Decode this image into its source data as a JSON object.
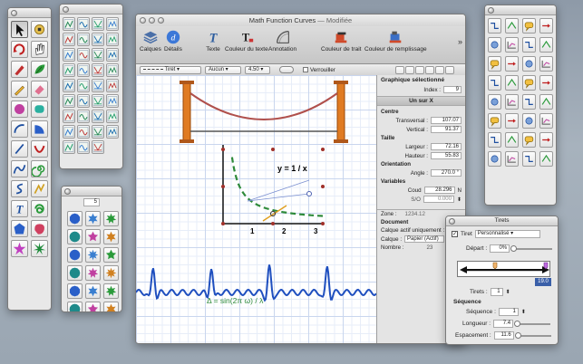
{
  "palette_left": {
    "tools": [
      "arrow-icon",
      "reshape-icon",
      "rotate-icon",
      "hand-icon",
      "pen-icon",
      "leaf-icon",
      "pencil-icon",
      "eraser-icon",
      "circle-icon",
      "rounded-rect-icon",
      "arc-icon",
      "wedge-icon",
      "line-icon",
      "curve-icon",
      "bezier-icon",
      "spiral-icon",
      "s-curve-icon",
      "freehand-icon",
      "text-icon",
      "swirl-icon",
      "polygon-icon",
      "blob-icon",
      "star-icon",
      "burst-icon"
    ]
  },
  "palette_mid_top": {
    "count": 35
  },
  "palette_mid_bottom": {
    "field_value": "5",
    "count": 24
  },
  "palette_right": {
    "count": 32
  },
  "main": {
    "title": "Math  Function Curves",
    "title_state": "— Modifiée",
    "toolbar": {
      "layers": "Calques",
      "details": "Détails",
      "text": "Texte",
      "text_color": "Couleur du texte",
      "annotation": "Annotation",
      "stroke_color": "Couleur de trait",
      "fill_color": "Couleur de remplissage"
    },
    "stylebar": {
      "dash": "Tiret",
      "arrow": "Aucun",
      "width": "4.50",
      "lock": "Verrouiller"
    },
    "canvas": {
      "function_label": "y = 1 / x",
      "x_ticks": [
        "1",
        "2",
        "3"
      ],
      "sine_label": "Δ = sin(2π ω) / λ"
    },
    "inspector": {
      "selected_header": "Graphique sélectionné",
      "index_label": "Index :",
      "index_value": "9",
      "object_name": "Un sur X",
      "centre_label": "Centre",
      "transversal_label": "Transversal :",
      "transversal_value": "107.07",
      "vertical_label": "Vertical :",
      "vertical_value": "91.37",
      "size_label": "Taille",
      "width_label": "Largeur :",
      "width_value": "72.16",
      "height_label": "Hauteur :",
      "height_value": "55.83",
      "orientation_label": "Orientation",
      "angle_label": "Angle :",
      "angle_value": "270.0 °",
      "variables_label": "Variables",
      "coud_label": "Coud",
      "coud_value": "28.296",
      "n_label": "N",
      "so_label": "S/O",
      "so_value": "0.000",
      "zone_label": "Zone :",
      "zone_value": "1234.12",
      "document_label": "Document",
      "active_layer_label": "Calque actif uniquement :",
      "layer_label": "Calque :",
      "layer_value": "Papier (Actif)",
      "count_label": "Nombre :",
      "count_value": "23"
    }
  },
  "dash_panel": {
    "title": "Tirets",
    "dash_checkbox": "Tiret",
    "preset": "Personnalisé",
    "start_label": "Départ :",
    "start_value": "0%",
    "ruler_value": "19.0",
    "dashes_label": "Tirets :",
    "dashes_value": "1",
    "sequence_label": "Séquence",
    "sequence_field_label": "Séquence :",
    "sequence_value": "1",
    "length_label": "Longueur :",
    "length_value": "7.4",
    "spacing_label": "Espacement :",
    "spacing_value": "11.6"
  }
}
